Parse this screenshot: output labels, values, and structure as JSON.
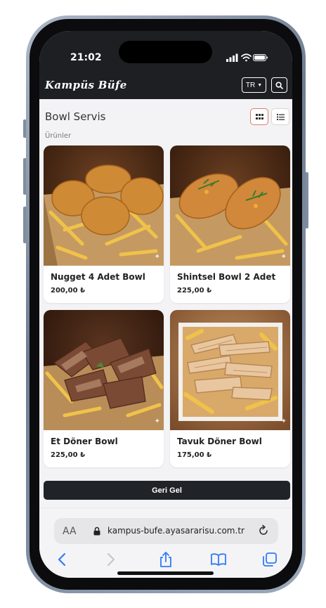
{
  "status_bar": {
    "time": "21:02"
  },
  "navbar": {
    "brand": "Kampüs Büfe",
    "language": "TR",
    "search_icon": "search-icon"
  },
  "page": {
    "title": "Bowl Servis",
    "breadcrumb": "Ürünler"
  },
  "view_toggle": {
    "active": "grid",
    "grid_icon": "grid-view-icon",
    "list_icon": "list-view-icon"
  },
  "products": [
    {
      "name": "Nugget 4 Adet Bowl",
      "price": "200,00 ₺"
    },
    {
      "name": "Shintsel Bowl 2 Adet",
      "price": "225,00 ₺"
    },
    {
      "name": "Et Döner Bowl",
      "price": "225,00 ₺"
    },
    {
      "name": "Tavuk Döner Bowl",
      "price": "175,00 ₺"
    }
  ],
  "back_button": "Geri Gel",
  "browser": {
    "aa_label": "AA",
    "url": "kampus-bufe.ayasararisu.com.tr",
    "toolbar_icons": [
      "back-icon",
      "forward-icon",
      "share-icon",
      "bookmarks-icon",
      "tabs-icon"
    ]
  },
  "colors": {
    "navbar": "#1d1f22",
    "accent_border": "#e07a6a",
    "button": "#202327"
  }
}
